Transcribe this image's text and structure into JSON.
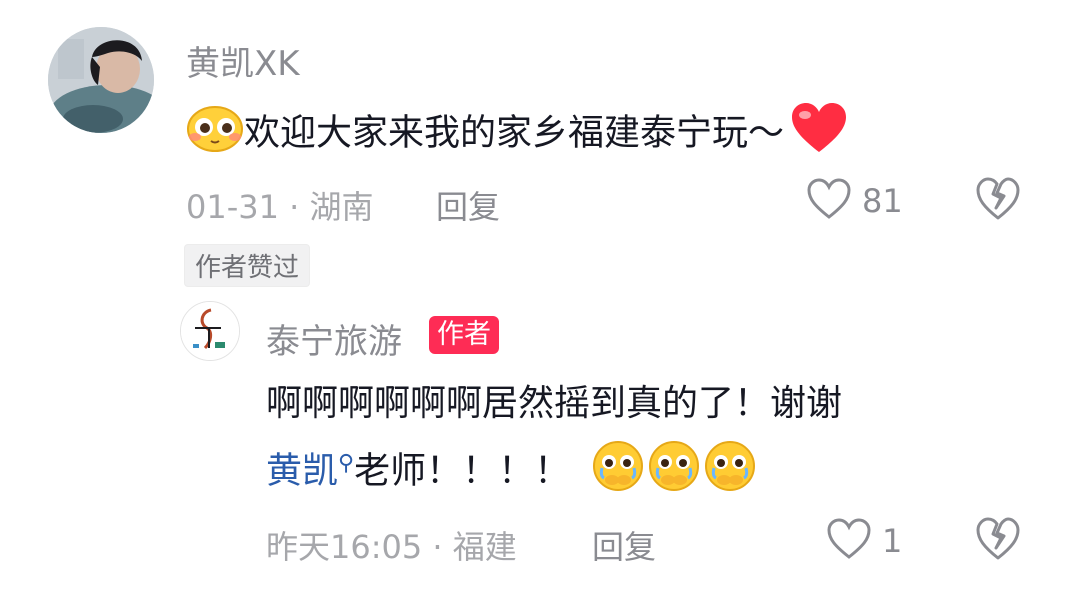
{
  "comment": {
    "username": "黄凯XK",
    "text": "欢迎大家来我的家乡福建泰宁玩～",
    "date_location": "01-31 · 湖南",
    "reply_label": "回复",
    "like_count": "81",
    "author_liked_badge": "作者赞过",
    "emoji_leading": "blushing-face-emoji",
    "emoji_trailing": "red-heart-emoji"
  },
  "reply": {
    "username": "泰宁旅游",
    "author_tag": "作者",
    "text_line1": "啊啊啊啊啊啊居然摇到真的了！谢谢",
    "mention": "黄凯",
    "text_line2": "老师！！！！",
    "date_location": "昨天16:05 · 福建",
    "reply_label": "回复",
    "like_count": "1",
    "emojis": [
      "pleading-face-emoji",
      "pleading-face-emoji",
      "pleading-face-emoji"
    ]
  },
  "colors": {
    "heart_red": "#ff2d42",
    "author_tag": "#fe2c55",
    "mention_blue": "#2a5cab"
  }
}
